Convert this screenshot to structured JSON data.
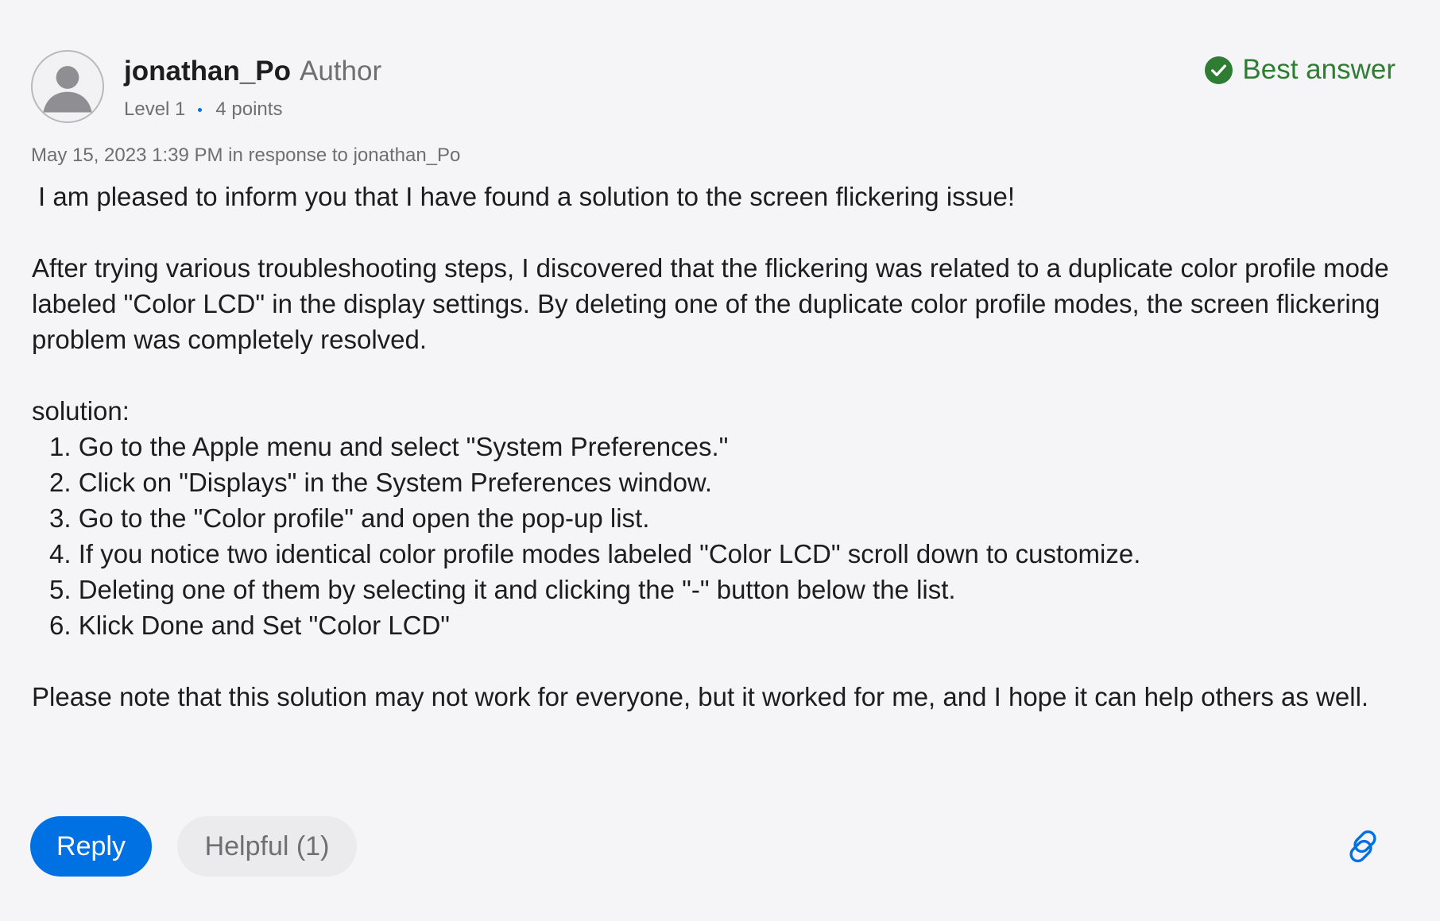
{
  "post": {
    "author": {
      "username": "jonathan_Po",
      "badge": "Author",
      "level": "Level 1",
      "points": "4 points",
      "avatar_icon": "user-avatar-icon"
    },
    "best_answer": {
      "label": "Best answer",
      "icon": "check-circle-icon",
      "color": "#2f7d32"
    },
    "timestamp": "May 15, 2023 1:39 PM in response to jonathan_Po",
    "body": {
      "intro": "I am pleased to inform you that I have found a solution to the screen flickering issue!",
      "paragraph": "After trying various troubleshooting steps, I discovered that the flickering was related to a duplicate color profile mode labeled \"Color LCD\" in the display settings. By deleting one of the duplicate color profile modes, the screen flickering problem was completely resolved.",
      "solution_heading": "solution:",
      "steps": [
        "1. Go to the Apple menu and select \"System Preferences.\"",
        "2. Click on \"Displays\" in the System Preferences window.",
        "3. Go to the \"Color profile\" and open the pop-up list.",
        "4. If you notice two identical color profile modes labeled \"Color LCD\" scroll down to customize.",
        "5. Deleting one of them by selecting it and clicking the \"-\" button below the list.",
        "6. Klick Done and Set \"Color LCD\""
      ],
      "closing": "Please note that this solution may not work for everyone, but it worked for me, and I hope it can help others as well."
    },
    "actions": {
      "reply_label": "Reply",
      "helpful_label": "Helpful (1)",
      "link_icon": "link-icon"
    }
  },
  "colors": {
    "accent": "#0071e3",
    "background": "#f5f5f7",
    "success": "#2f7d32",
    "secondary_text": "#6e6e73"
  }
}
